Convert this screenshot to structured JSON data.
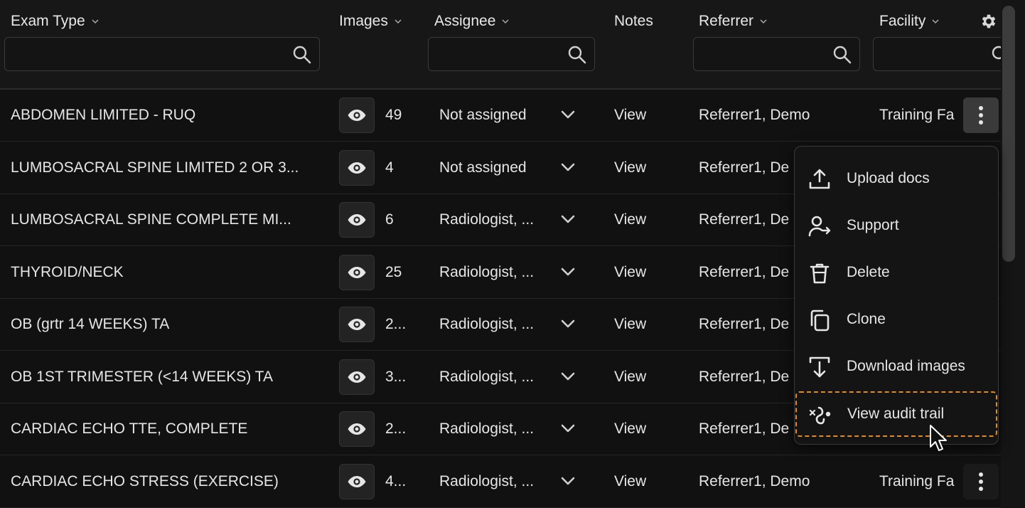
{
  "header": {
    "columns": {
      "exam_type": "Exam Type",
      "images": "Images",
      "assignee": "Assignee",
      "notes": "Notes",
      "referrer": "Referrer",
      "facility": "Facility"
    }
  },
  "filters": {
    "exam_type": "",
    "assignee": "",
    "referrer": "",
    "facility": ""
  },
  "icons": {
    "column_chevron": "chevron-down-icon",
    "search": "search-icon",
    "settings": "gear-icon",
    "view_images": "eye-icon",
    "assignee_dropdown": "chevron-down-icon",
    "row_actions": "more-vertical-icon"
  },
  "rows": [
    {
      "exam_type": "ABDOMEN LIMITED - RUQ",
      "images": "49",
      "assignee": "Not assigned",
      "notes": "View",
      "referrer": "Referrer1, Demo",
      "facility": "Training Fa"
    },
    {
      "exam_type": "LUMBOSACRAL SPINE LIMITED 2 OR 3...",
      "images": "4",
      "assignee": "Not assigned",
      "notes": "View",
      "referrer": "Referrer1, De",
      "facility": ""
    },
    {
      "exam_type": "LUMBOSACRAL SPINE COMPLETE MI...",
      "images": "6",
      "assignee": "Radiologist, ...",
      "notes": "View",
      "referrer": "Referrer1, De",
      "facility": ""
    },
    {
      "exam_type": "THYROID/NECK",
      "images": "25",
      "assignee": "Radiologist, ...",
      "notes": "View",
      "referrer": "Referrer1, De",
      "facility": ""
    },
    {
      "exam_type": "OB (grtr 14 WEEKS) TA",
      "images": "2...",
      "assignee": "Radiologist, ...",
      "notes": "View",
      "referrer": "Referrer1, De",
      "facility": ""
    },
    {
      "exam_type": "OB 1ST TRIMESTER (<14 WEEKS) TA",
      "images": "3...",
      "assignee": "Radiologist, ...",
      "notes": "View",
      "referrer": "Referrer1, De",
      "facility": ""
    },
    {
      "exam_type": "CARDIAC ECHO TTE, COMPLETE",
      "images": "2...",
      "assignee": "Radiologist, ...",
      "notes": "View",
      "referrer": "Referrer1, De",
      "facility": ""
    },
    {
      "exam_type": "CARDIAC ECHO STRESS (EXERCISE)",
      "images": "4...",
      "assignee": "Radiologist, ...",
      "notes": "View",
      "referrer": "Referrer1, Demo",
      "facility": "Training Fa"
    }
  ],
  "context_menu": {
    "items": [
      {
        "label": "Upload docs",
        "icon": "upload-icon"
      },
      {
        "label": "Support",
        "icon": "user-share-icon"
      },
      {
        "label": "Delete",
        "icon": "trash-icon"
      },
      {
        "label": "Clone",
        "icon": "copy-icon"
      },
      {
        "label": "Download images",
        "icon": "download-icon"
      },
      {
        "label": "View audit trail",
        "icon": "route-icon"
      }
    ]
  },
  "colors": {
    "background": "#111111",
    "header": "#171717",
    "focus_outline": "#e08a2c",
    "text": "#e6e6e6"
  }
}
